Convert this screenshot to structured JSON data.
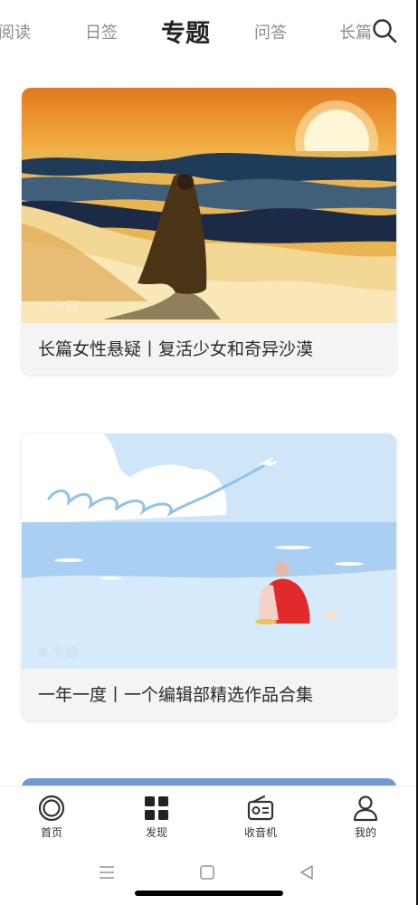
{
  "top_tabs": {
    "items": [
      {
        "label": "阅读"
      },
      {
        "label": "日签"
      },
      {
        "label": "专题",
        "active": true
      },
      {
        "label": "问答"
      },
      {
        "label": "长篇"
      }
    ],
    "search_icon": "search-icon"
  },
  "cards": [
    {
      "tag": "# 专题",
      "title": "长篇女性悬疑丨复活少女和奇异沙漠",
      "art": "desert-woman-sunset-illustration"
    },
    {
      "tag": "# 专题",
      "title": "一年一度丨一个编辑部精选作品合集",
      "art": "2024-sea-sky-airplane-illustration"
    }
  ],
  "bottom_nav": {
    "items": [
      {
        "label": "首页",
        "icon": "home-circle-icon"
      },
      {
        "label": "发现",
        "icon": "grid-icon",
        "active": true
      },
      {
        "label": "收音机",
        "icon": "radio-icon"
      },
      {
        "label": "我的",
        "icon": "person-icon"
      }
    ]
  },
  "system_nav": {
    "icons": [
      "menu-icon",
      "square-icon",
      "back-triangle-icon"
    ]
  },
  "colors": {
    "accent_text": "#222222",
    "inactive_text": "#8d8d8d",
    "card_bg": "#f4f4f4"
  }
}
